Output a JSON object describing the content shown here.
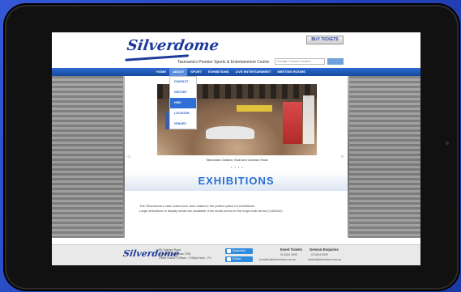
{
  "site": {
    "logo_text": "Silverdome",
    "tagline": "Tasmania's Premier Sports & Entertainment Centre",
    "buy_tickets": "BUY TICKETS",
    "search_placeholder": "Google Custom Search"
  },
  "nav": [
    "HOME",
    "ABOUT",
    "SPORT",
    "EXHIBITIONS",
    "LIVE ENTERTAINMENT",
    "MEETING ROOMS"
  ],
  "dropdown": [
    "CONTACT",
    "HISTORY",
    "HIRE",
    "LOCATION",
    "VENUES"
  ],
  "hero": {
    "caption": "Tasmanian Outdoor, Boat and Caravan Show",
    "dots": "• • • •"
  },
  "main": {
    "heading": "EXHIBITIONS",
    "paragraph_1": "The Silverdome's vast undercover area makes it the perfect place for exhibitions.",
    "paragraph_2": "Large selections of display areas are available, from small rooms to the huge main arena (4,000m2)."
  },
  "footer": {
    "logo_text": "Silverdome",
    "address_1": "55 Oakden Road",
    "address_2": "Prospect Tasmania 7250",
    "address_3": "Office Hours: 9.00am - 5.00pm Mon - Fri",
    "subscribe": "Subscribe",
    "follow": "Follow",
    "event_title": "Event Tickets",
    "event_phone": "03 6344 9999",
    "event_email": "boxoffice@silverdome.com.au",
    "general_title": "General Enquiries",
    "general_phone": "03 6344 9999",
    "general_email": "admin@silverdome.com.au"
  },
  "colors": {
    "brand_blue": "#1d3b9c",
    "nav_blue": "#164a9f",
    "heading_blue": "#2a6fd0",
    "desktop_bg": "#2a4fc7"
  }
}
